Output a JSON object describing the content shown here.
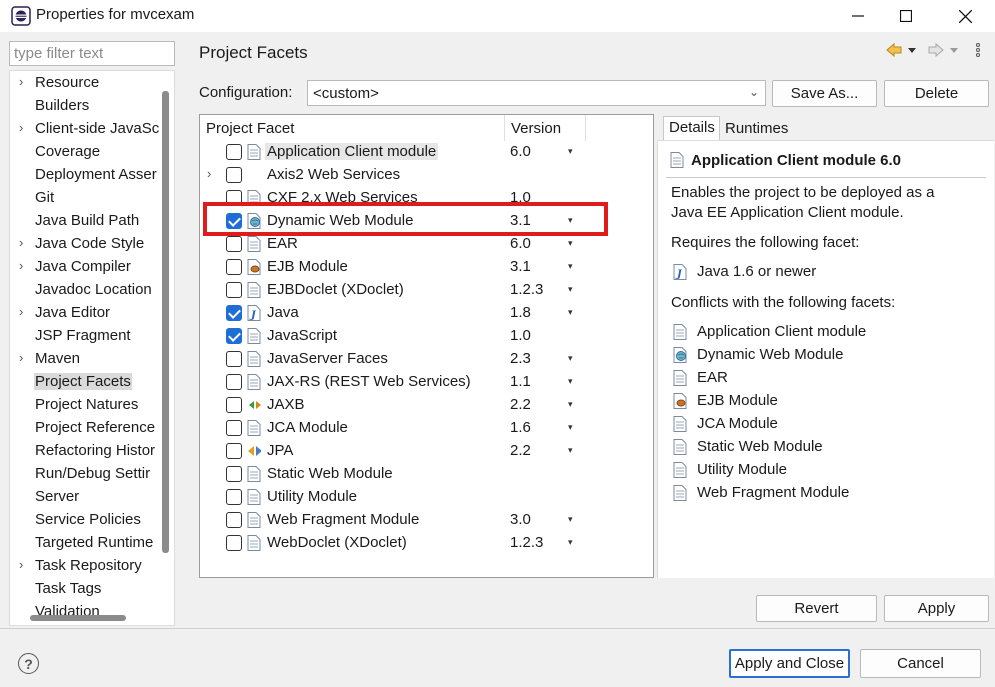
{
  "window": {
    "title": "Properties for mvcexam",
    "controls": {
      "minimize": "minimize-icon",
      "maximize": "maximize-icon",
      "close": "close-icon"
    }
  },
  "filter": {
    "placeholder": "type filter text",
    "value": ""
  },
  "nav": {
    "items": [
      {
        "label": "Resource",
        "expandable": true
      },
      {
        "label": "Builders",
        "expandable": false
      },
      {
        "label": "Client-side JavaSc",
        "expandable": true
      },
      {
        "label": "Coverage",
        "expandable": false
      },
      {
        "label": "Deployment Asser",
        "expandable": false
      },
      {
        "label": "Git",
        "expandable": false
      },
      {
        "label": "Java Build Path",
        "expandable": false
      },
      {
        "label": "Java Code Style",
        "expandable": true
      },
      {
        "label": "Java Compiler",
        "expandable": true
      },
      {
        "label": "Javadoc Location",
        "expandable": false
      },
      {
        "label": "Java Editor",
        "expandable": true
      },
      {
        "label": "JSP Fragment",
        "expandable": false
      },
      {
        "label": "Maven",
        "expandable": true
      },
      {
        "label": "Project Facets",
        "expandable": false,
        "selected": true
      },
      {
        "label": "Project Natures",
        "expandable": false
      },
      {
        "label": "Project Reference",
        "expandable": false
      },
      {
        "label": "Refactoring Histor",
        "expandable": false
      },
      {
        "label": "Run/Debug Settir",
        "expandable": false
      },
      {
        "label": "Server",
        "expandable": false
      },
      {
        "label": "Service Policies",
        "expandable": false
      },
      {
        "label": "Targeted Runtime",
        "expandable": false
      },
      {
        "label": "Task Repository",
        "expandable": true
      },
      {
        "label": "Task Tags",
        "expandable": false
      },
      {
        "label": "Validation",
        "expandable": false
      }
    ]
  },
  "page": {
    "title": "Project Facets"
  },
  "config": {
    "label": "Configuration:",
    "value": "<custom>",
    "save_as": "Save As...",
    "delete": "Delete"
  },
  "facets": {
    "col_facet": "Project Facet",
    "col_version": "Version",
    "rows": [
      {
        "name": "Application Client module",
        "version": "6.0",
        "checked": false,
        "icon": "page-icon",
        "dropdown": true,
        "highlighted": true
      },
      {
        "name": "Axis2 Web Services",
        "version": "",
        "checked": false,
        "icon": "",
        "dropdown": false,
        "expandable": true
      },
      {
        "name": "CXF 2.x Web Services",
        "version": "1.0",
        "checked": false,
        "icon": "page-icon",
        "dropdown": false
      },
      {
        "name": "Dynamic Web Module",
        "version": "3.1",
        "checked": true,
        "icon": "globe-page-icon",
        "dropdown": true
      },
      {
        "name": "EAR",
        "version": "6.0",
        "checked": false,
        "icon": "page-icon",
        "dropdown": true
      },
      {
        "name": "EJB Module",
        "version": "3.1",
        "checked": false,
        "icon": "bean-page-icon",
        "dropdown": true
      },
      {
        "name": "EJBDoclet (XDoclet)",
        "version": "1.2.3",
        "checked": false,
        "icon": "page-icon",
        "dropdown": true
      },
      {
        "name": "Java",
        "version": "1.8",
        "checked": true,
        "icon": "java-icon",
        "dropdown": true
      },
      {
        "name": "JavaScript",
        "version": "1.0",
        "checked": true,
        "icon": "page-icon",
        "dropdown": false
      },
      {
        "name": "JavaServer Faces",
        "version": "2.3",
        "checked": false,
        "icon": "page-icon",
        "dropdown": true
      },
      {
        "name": "JAX-RS (REST Web Services)",
        "version": "1.1",
        "checked": false,
        "icon": "page-icon",
        "dropdown": true
      },
      {
        "name": "JAXB",
        "version": "2.2",
        "checked": false,
        "icon": "jaxb-icon",
        "dropdown": true
      },
      {
        "name": "JCA Module",
        "version": "1.6",
        "checked": false,
        "icon": "page-icon",
        "dropdown": true
      },
      {
        "name": "JPA",
        "version": "2.2",
        "checked": false,
        "icon": "jpa-icon",
        "dropdown": true
      },
      {
        "name": "Static Web Module",
        "version": "",
        "checked": false,
        "icon": "page-icon",
        "dropdown": false
      },
      {
        "name": "Utility Module",
        "version": "",
        "checked": false,
        "icon": "page-icon",
        "dropdown": false
      },
      {
        "name": "Web Fragment Module",
        "version": "3.0",
        "checked": false,
        "icon": "page-icon",
        "dropdown": true
      },
      {
        "name": "WebDoclet (XDoclet)",
        "version": "1.2.3",
        "checked": false,
        "icon": "page-icon",
        "dropdown": true
      }
    ]
  },
  "details": {
    "tab_details": "Details",
    "tab_runtimes": "Runtimes",
    "title": "Application Client module 6.0",
    "description_line1": "Enables the project to be deployed as a",
    "description_line2": "Java EE Application Client module.",
    "requires_label": "Requires the following facet:",
    "requires": [
      {
        "name": "Java 1.6 or newer",
        "icon": "java-icon"
      }
    ],
    "conflicts_label": "Conflicts with the following facets:",
    "conflicts": [
      {
        "name": "Application Client module",
        "icon": "page-icon"
      },
      {
        "name": "Dynamic Web Module",
        "icon": "globe-page-icon"
      },
      {
        "name": "EAR",
        "icon": "page-icon"
      },
      {
        "name": "EJB Module",
        "icon": "bean-page-icon"
      },
      {
        "name": "JCA Module",
        "icon": "page-icon"
      },
      {
        "name": "Static Web Module",
        "icon": "page-icon"
      },
      {
        "name": "Utility Module",
        "icon": "page-icon"
      },
      {
        "name": "Web Fragment Module",
        "icon": "page-icon"
      }
    ]
  },
  "buttons": {
    "revert": "Revert",
    "apply": "Apply",
    "apply_close": "Apply and Close",
    "cancel": "Cancel",
    "help": "?"
  },
  "colors": {
    "checkbox_checked": "#1f6ed6",
    "annotation_red": "#e01b1b",
    "default_button_border": "#2b6fd0"
  }
}
